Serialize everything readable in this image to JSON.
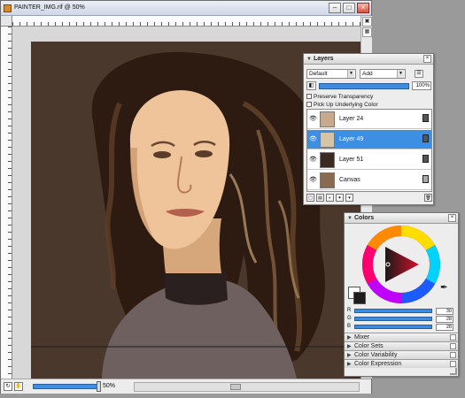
{
  "document": {
    "title": "PAINTER_IMG.rif @ 50%",
    "zoom_label": "50%",
    "win_minimize": "–",
    "win_maximize": "□",
    "win_close": "×"
  },
  "layers_panel": {
    "title": "Layers",
    "composite_method": "Default",
    "composite_depth": "Add",
    "opacity_value": "100%",
    "preserve_transparency": "Preserve Transparency",
    "pick_up_underlying": "Pick Up Underlying Color",
    "layers": [
      {
        "name": "Layer 24",
        "selected": false,
        "thumb_color": "#c9a98e"
      },
      {
        "name": "Layer 49",
        "selected": true,
        "thumb_color": "#d7c3a6"
      },
      {
        "name": "Layer 51",
        "selected": false,
        "thumb_color": "#3a2a22"
      },
      {
        "name": "Canvas",
        "selected": false,
        "thumb_color": "#8a6a4e"
      }
    ]
  },
  "colors_panel": {
    "title": "Colors",
    "sliders": [
      {
        "label": "R",
        "value": "30"
      },
      {
        "label": "G",
        "value": "28"
      },
      {
        "label": "B",
        "value": "28"
      }
    ],
    "sub_panels": [
      "Mixer",
      "Color Sets",
      "Color Variability",
      "Color Expression"
    ]
  },
  "colors": {
    "accent_blue": "#3d8fe3",
    "painting_background": "#4b382d",
    "main_color": "#1e1c1c"
  }
}
